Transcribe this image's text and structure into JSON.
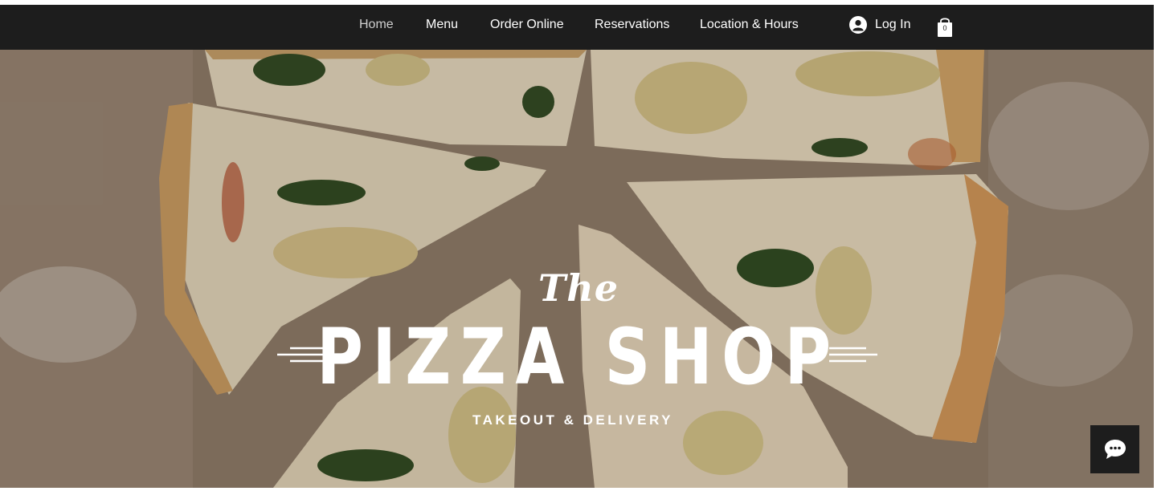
{
  "nav": {
    "items": [
      {
        "label": "Home",
        "active": true
      },
      {
        "label": "Menu",
        "active": false
      },
      {
        "label": "Order Online",
        "active": false
      },
      {
        "label": "Reservations",
        "active": false
      },
      {
        "label": "Location & Hours",
        "active": false
      }
    ],
    "login_label": "Log In",
    "login_icon": "user-avatar-icon",
    "cart_icon": "shopping-bag-icon",
    "cart_count": "0"
  },
  "hero": {
    "title_the": "The",
    "title_main": "PIZZA SHOP",
    "subtitle": "TAKEOUT & DELIVERY",
    "background": "sliced pizza on a floured wooden board"
  },
  "chat": {
    "icon": "chat-bubble-icon"
  },
  "colors": {
    "nav_bg": "#1d1d1d",
    "nav_text": "#ffffff",
    "nav_active_text": "#cfcfcf",
    "hero_text": "#ffffff"
  }
}
